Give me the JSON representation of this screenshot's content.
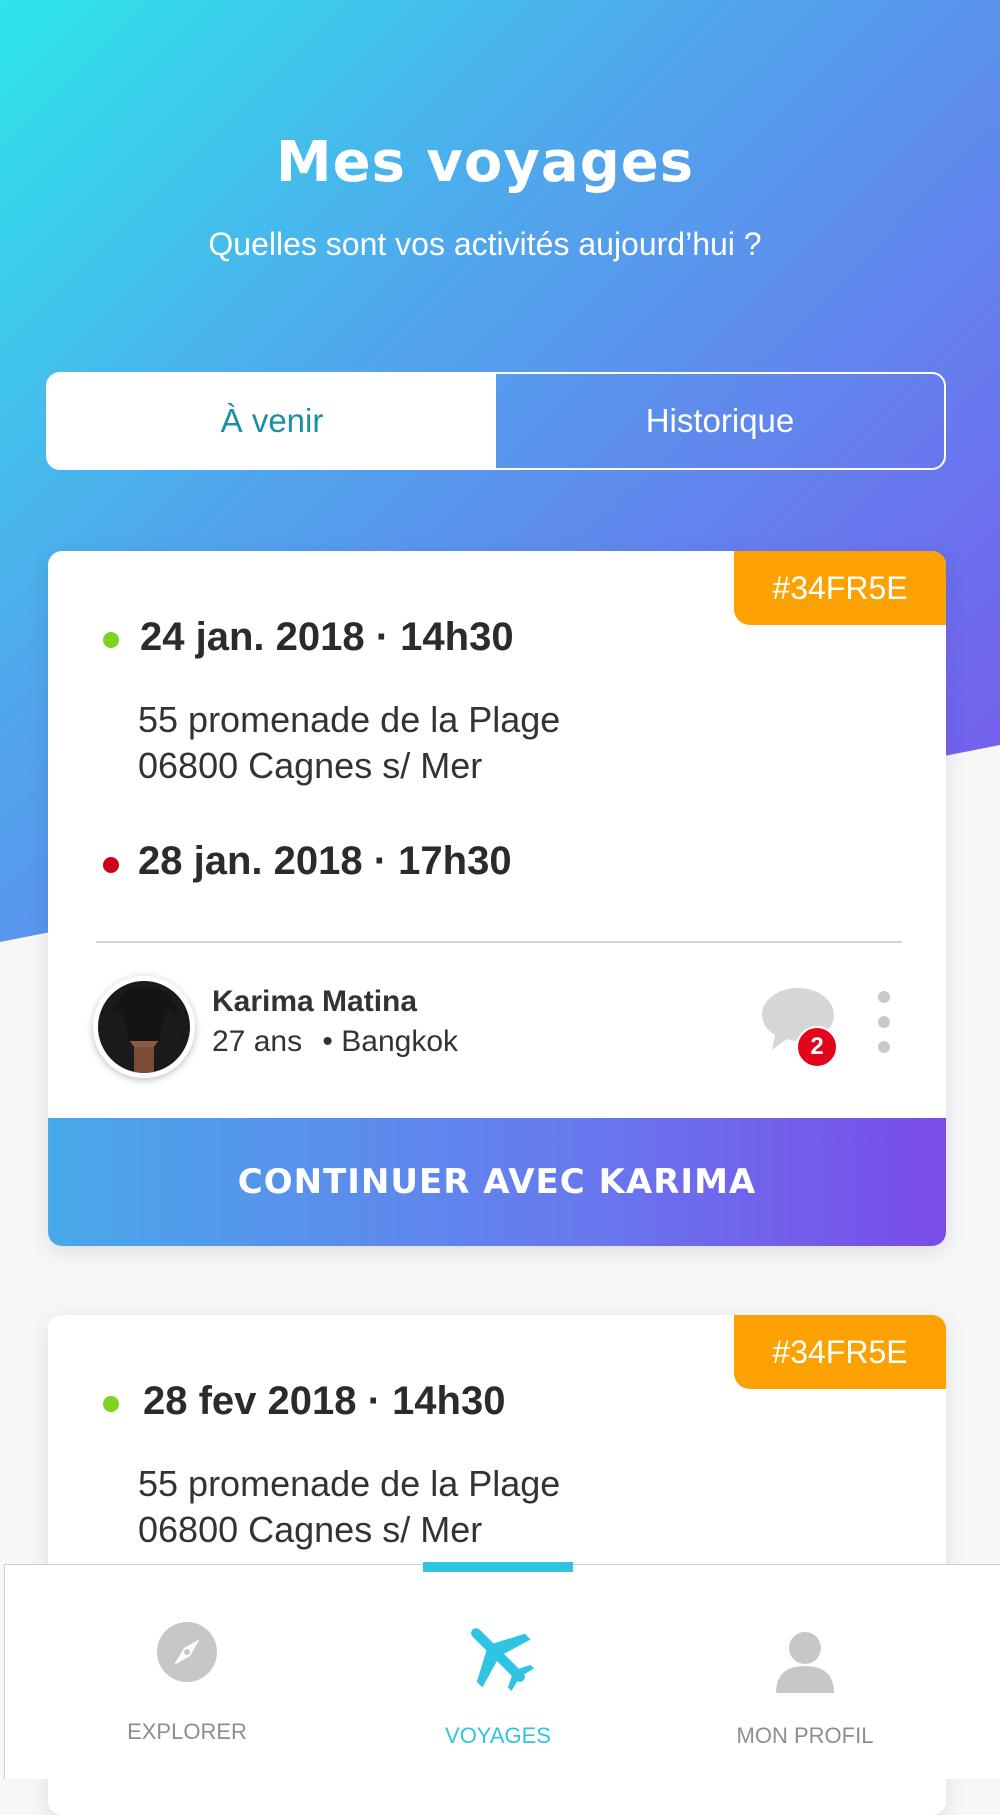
{
  "header": {
    "title": "Mes voyages",
    "subtitle": "Quelles sont vos activités aujourd’hui ?"
  },
  "segments": {
    "active": "À venir",
    "inactive": "Historique"
  },
  "trips": [
    {
      "code": "#34FR5E",
      "departure": {
        "date": "24 jan. 2018 · 14h30",
        "address_line1": "55 promenade de la Plage",
        "address_line2": "06800 Cagnes s/ Mer",
        "status_color": "#7ed321"
      },
      "return": {
        "date": "28 jan. 2018 · 17h30",
        "status_color": "#d0021b"
      },
      "traveler": {
        "name": "Karima Matina",
        "age": "27 ans",
        "city": "• Bangkok"
      },
      "unread_messages": "2",
      "cta_label": "CONTINUER AVEC KARIMA"
    },
    {
      "code": "#34FR5E",
      "departure": {
        "date": "28 fev 2018 · 14h30",
        "address_line1": "55 promenade de la Plage",
        "address_line2": "06800 Cagnes s/ Mer",
        "status_color": "#7ed321"
      }
    }
  ],
  "tabbar": {
    "items": [
      {
        "label": "EXPLORER",
        "icon": "compass-icon",
        "active": false
      },
      {
        "label": "VOYAGES",
        "icon": "airplane-icon",
        "active": true
      },
      {
        "label": "MON PROFIL",
        "icon": "user-icon",
        "active": false
      }
    ],
    "active_color": "#2fc5e2",
    "inactive_color": "#8e8e8e"
  },
  "colors": {
    "badge": "#fba102",
    "accent_teal": "#1c8fa8",
    "notification": "#e3051b"
  }
}
